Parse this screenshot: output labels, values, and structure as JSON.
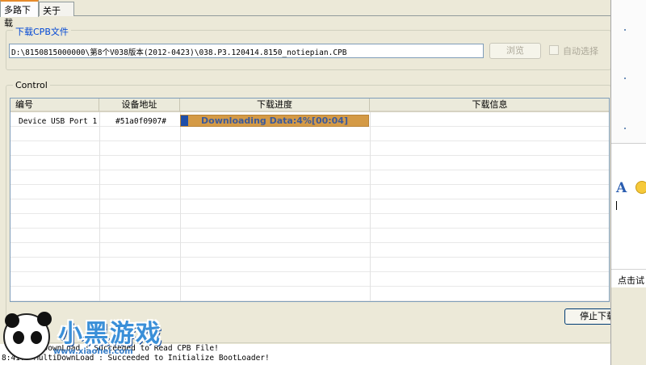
{
  "tabs": [
    {
      "label": "多路下载",
      "active": true
    },
    {
      "label": "关于",
      "active": false
    }
  ],
  "file_group": {
    "title": "下载CPB文件",
    "path": "D:\\8150815000000\\第8个V038版本(2012-0423)\\038.P3.120414.8150_notiepian.CPB",
    "browse_label": "浏览",
    "auto_select_label": "自动选择",
    "auto_select_checked": false
  },
  "control_group": {
    "title": "Control",
    "columns": [
      "编号",
      "设备地址",
      "下载进度",
      "下载信息"
    ],
    "rows": [
      {
        "id": "Device USB Port 1",
        "address": "#51a0f0907#",
        "progress_text": "Downloading Data:4%[00:04]",
        "progress_percent": 4,
        "info": ""
      }
    ],
    "stop_label": "停止下载"
  },
  "log": {
    "lines": [
      "        iDownLoad : Succeeded to Read CPB File!",
      "8:41:0 MultiDownLoad : Succeeded to Initialize BootLoader!"
    ]
  },
  "side_panel": {
    "font_button": "A",
    "link_text": "点击试"
  },
  "watermark": {
    "brand": "小黑游戏",
    "url": "www.xiaohei.com"
  },
  "colors": {
    "window_bg": "#ece9d8",
    "group_title": "#0046d5",
    "progress_bg": "#d49a46",
    "progress_fill": "#1f4ea8",
    "tab_highlight": "#e68b2c"
  }
}
